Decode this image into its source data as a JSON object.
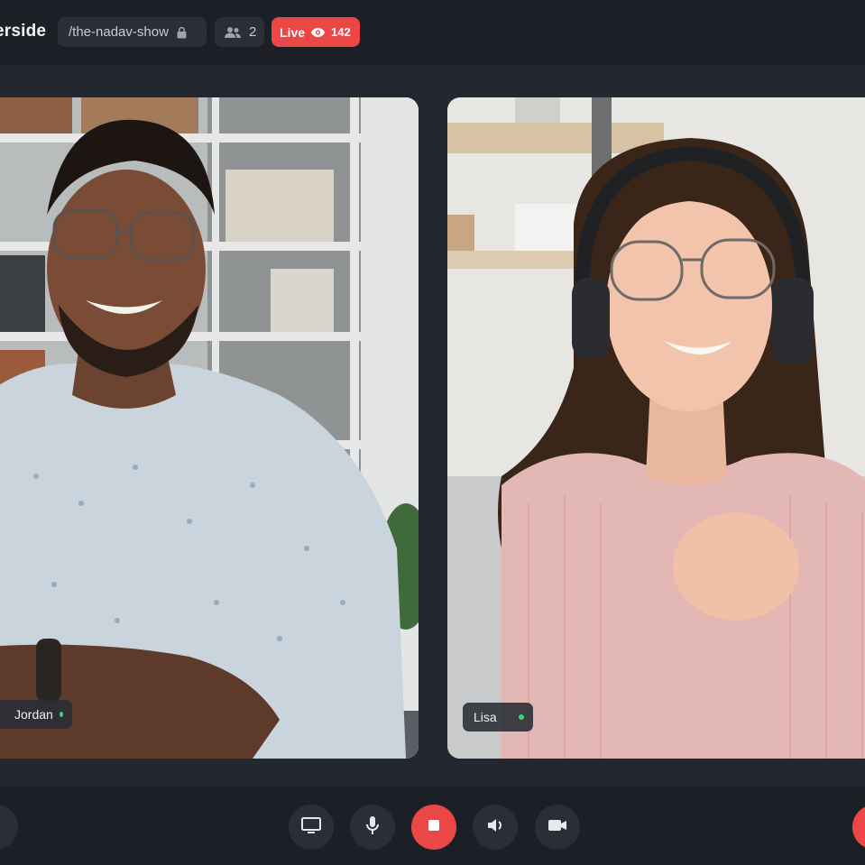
{
  "header": {
    "brand": "erside",
    "room_slug": "/the-nadav-show",
    "participants_count": "2",
    "live_label": "Live",
    "viewers_count": "142"
  },
  "participants": [
    {
      "name": "Jordan"
    },
    {
      "name": "Lisa"
    }
  ],
  "controls": [
    {
      "icon": "screen-share-icon"
    },
    {
      "icon": "microphone-icon"
    },
    {
      "icon": "stop-icon"
    },
    {
      "icon": "speaker-icon"
    },
    {
      "icon": "camera-icon"
    }
  ],
  "colors": {
    "background": "#1c1f26",
    "chip": "#2a2e37",
    "live_red": "#ec4747",
    "online_green": "#3fd07a"
  }
}
